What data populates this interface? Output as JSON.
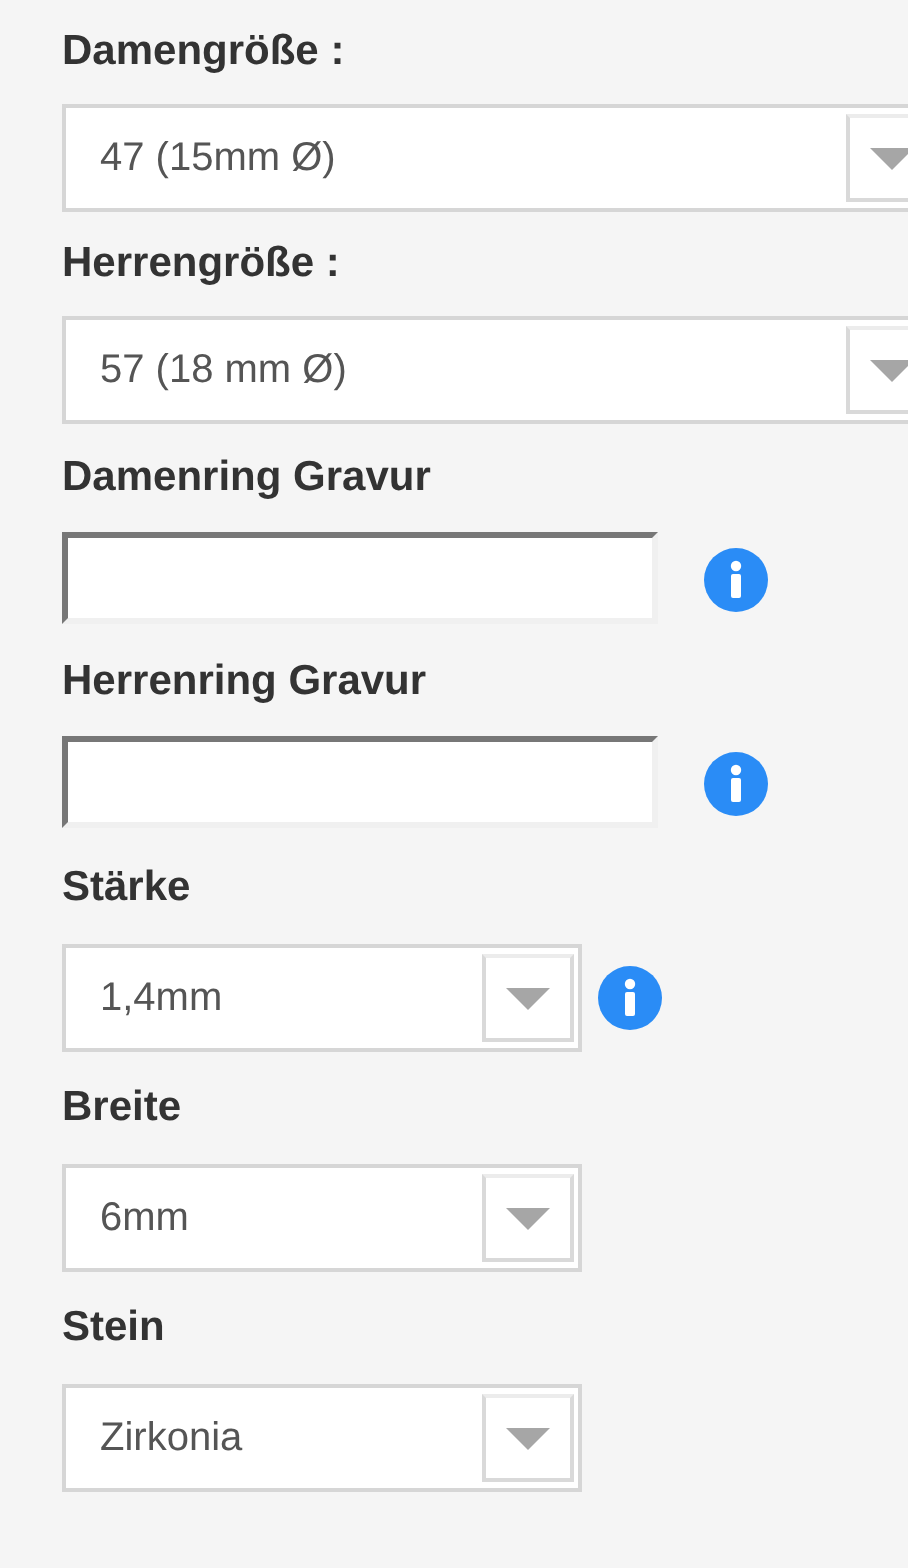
{
  "fields": [
    {
      "label": "Damengröße :",
      "kind": "wide-select",
      "value": "47 (15mm Ø)",
      "info": false
    },
    {
      "label": "Herrengröße :",
      "kind": "wide-select",
      "value": "57 (18 mm Ø)",
      "info": false
    },
    {
      "label": "Damenring Gravur",
      "kind": "text",
      "info": true
    },
    {
      "label": "Herrenring Gravur",
      "kind": "text",
      "info": true
    },
    {
      "label": "Stärke",
      "kind": "select",
      "value": "1,4mm",
      "info": true
    },
    {
      "label": "Breite",
      "kind": "select",
      "value": "6mm",
      "info": false
    },
    {
      "label": "Stein",
      "kind": "select",
      "value": "Zirkonia",
      "info": false
    }
  ]
}
